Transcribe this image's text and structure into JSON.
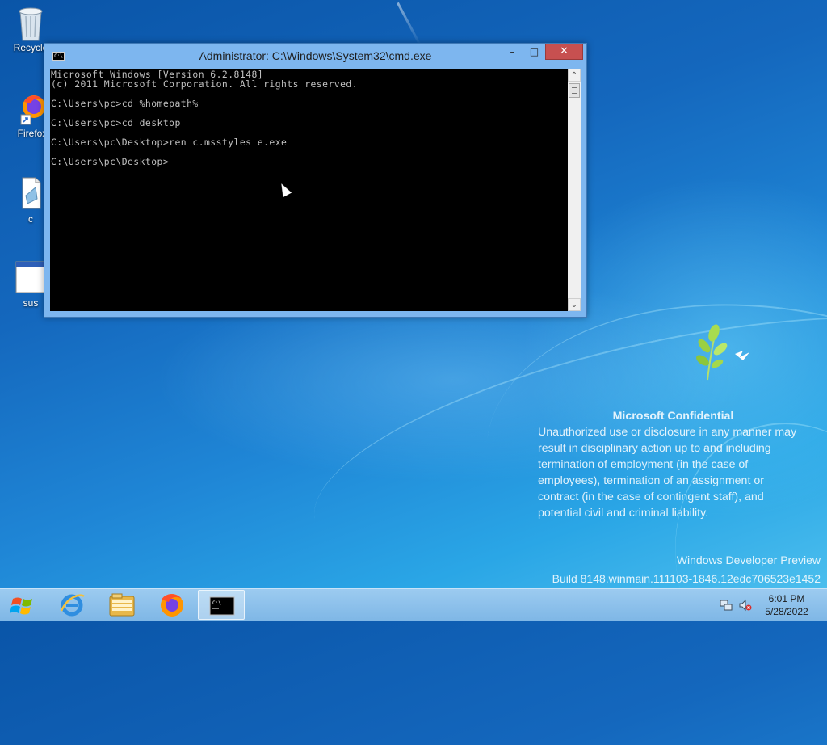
{
  "desktop": {
    "icons": [
      {
        "label": "Recycle",
        "icon": "recycle-bin-icon"
      },
      {
        "label": "Firefox",
        "icon": "firefox-shortcut-icon"
      },
      {
        "label": "c",
        "icon": "document-icon"
      },
      {
        "label": "sus",
        "icon": "window-app-icon"
      }
    ]
  },
  "window": {
    "title": "Administrator: C:\\Windows\\System32\\cmd.exe",
    "icon": "cmd-icon",
    "minimize_label": "–",
    "maximize_label": "□",
    "close_label": "✕"
  },
  "console": {
    "lines": [
      "Microsoft Windows [Version 6.2.8148]",
      "(c) 2011 Microsoft Corporation. All rights reserved.",
      "",
      "C:\\Users\\pc>cd %homepath%",
      "",
      "C:\\Users\\pc>cd desktop",
      "",
      "C:\\Users\\pc\\Desktop>ren c.msstyles e.exe",
      "",
      "C:\\Users\\pc\\Desktop>"
    ]
  },
  "watermark": {
    "title": "Microsoft Confidential",
    "body": "Unauthorized use or disclosure in any manner may\nresult in disciplinary action up to and including\ntermination of employment (in the case of\nemployees), termination of an assignment or\ncontract (in the case of contingent staff), and\npotential civil and criminal liability.",
    "edition": "Windows Developer Preview",
    "build": "Build 8148.winmain.111103-1846.12edc706523e1452"
  },
  "taskbar": {
    "items": [
      {
        "icon": "windows-start-icon"
      },
      {
        "icon": "internet-explorer-icon"
      },
      {
        "icon": "file-explorer-icon"
      },
      {
        "icon": "firefox-icon"
      },
      {
        "icon": "cmd-icon",
        "active": true
      }
    ],
    "tray": {
      "network_icon": "network-icon",
      "volume_icon": "volume-muted-icon",
      "time": "6:01 PM",
      "date": "5/28/2022"
    }
  },
  "colors": {
    "close_button": "#c75050",
    "window_frame": "#7db6ef",
    "console_bg": "#000000",
    "console_text": "#c0c0c0",
    "taskbar": "#8fc2ec"
  }
}
